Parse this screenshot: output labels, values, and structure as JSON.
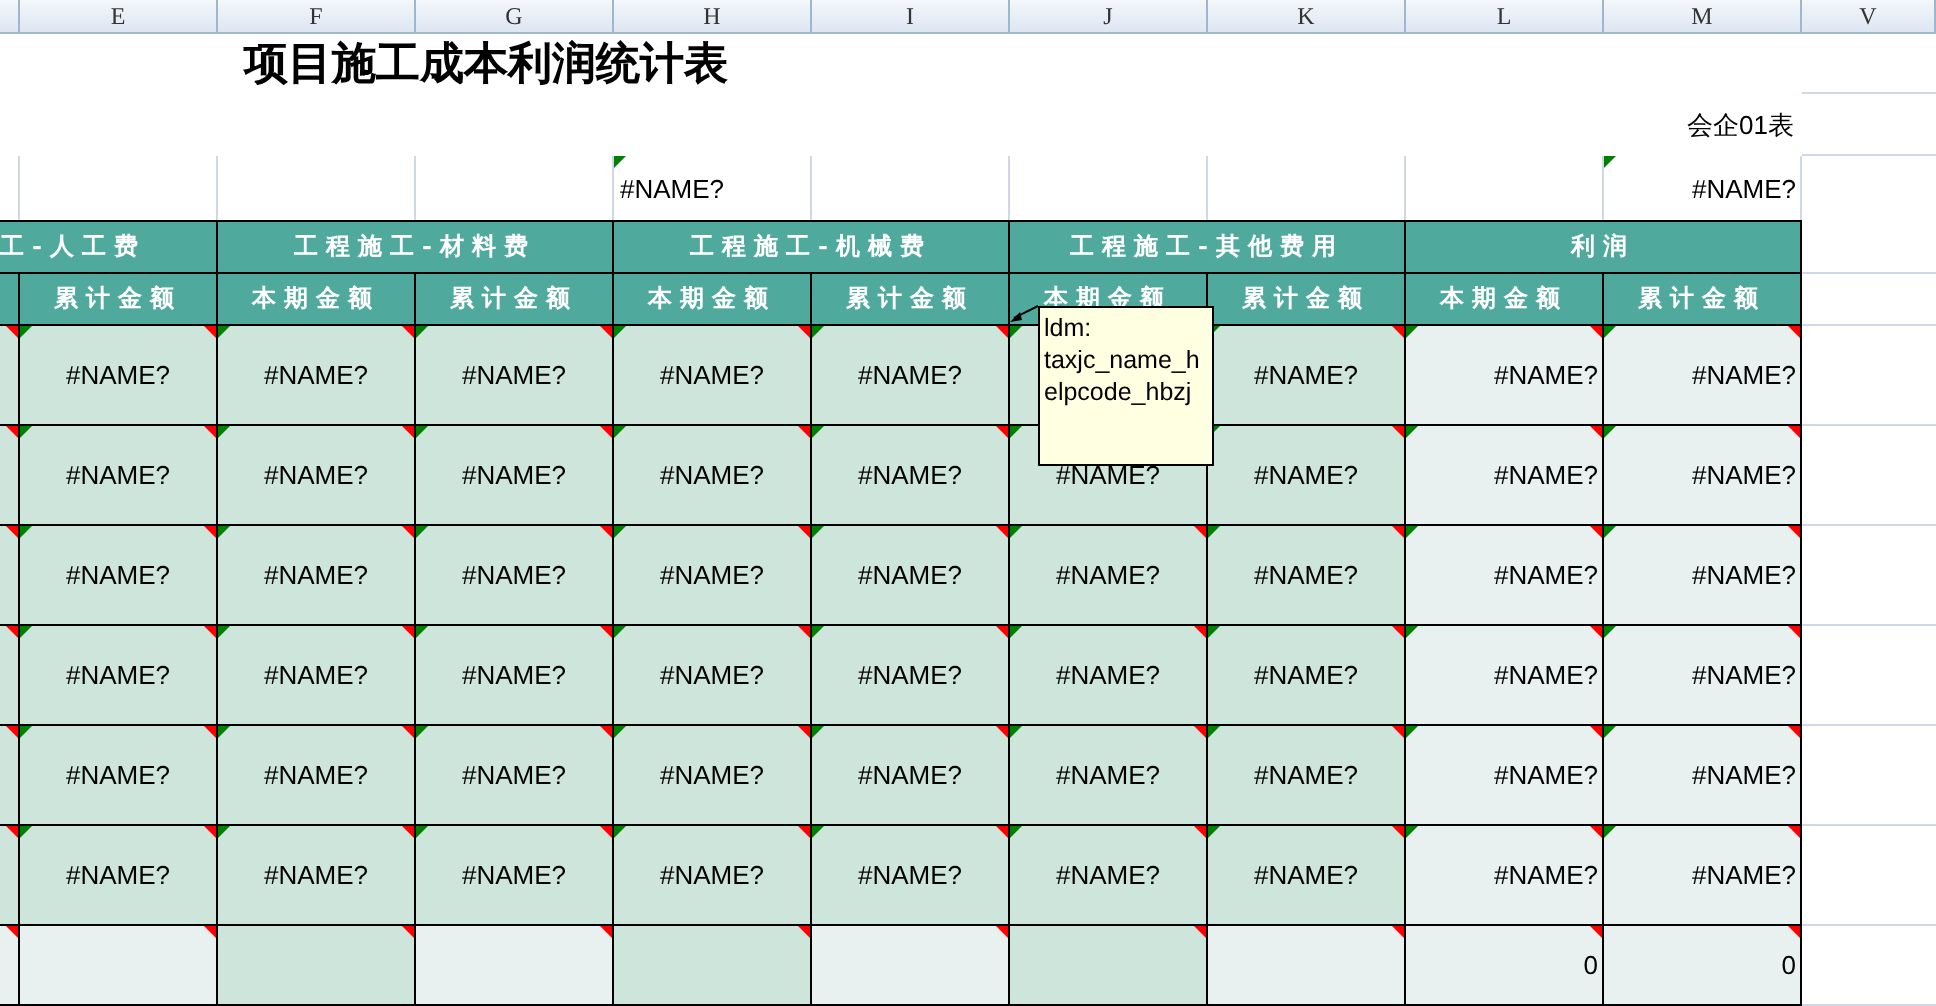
{
  "column_letters": [
    "E",
    "F",
    "G",
    "H",
    "I",
    "J",
    "K",
    "L",
    "M",
    "V"
  ],
  "title": "项目施工成本利润统计表",
  "form_code": "会企01表",
  "top_cells": [
    {
      "text": "#NAME?"
    },
    {
      "text": "#NAME?"
    }
  ],
  "group_headers": [
    "工-人工费",
    "工程施工-材料费",
    "工程施工-机械费",
    "工程施工-其他费用",
    "利润"
  ],
  "sub_headers": [
    "累计金额",
    "本期金额",
    "累计金额",
    "本期金额",
    "累计金额",
    "本期金额",
    "累计金额",
    "本期金额",
    "累计金额"
  ],
  "rows": [
    {
      "kind": "data",
      "cells": [
        {
          "text": "#NAME?",
          "color": "#cde5da"
        },
        {
          "text": "#NAME?",
          "color": "#cde5da"
        },
        {
          "text": "#NAME?",
          "color": "#cde5da"
        },
        {
          "text": "#NAME?",
          "color": "#cde5da"
        },
        {
          "text": "#NAME?",
          "color": "#cde5da"
        },
        {
          "color": "#cde5da"
        },
        {
          "text": "#NAME?",
          "color": "#cde5da"
        },
        {
          "text": "#NAME?",
          "color": "#e8f1ef"
        },
        {
          "text": "#NAME?",
          "color": "#e8f1ef"
        }
      ]
    },
    {
      "kind": "data",
      "cells": [
        {
          "text": "#NAME?",
          "color": "#cde5da"
        },
        {
          "text": "#NAME?",
          "color": "#cde5da"
        },
        {
          "text": "#NAME?",
          "color": "#cde5da"
        },
        {
          "text": "#NAME?",
          "color": "#cde5da"
        },
        {
          "text": "#NAME?",
          "color": "#cde5da"
        },
        {
          "text": "#NAME?",
          "color": "#cde5da"
        },
        {
          "text": "#NAME?",
          "color": "#cde5da"
        },
        {
          "text": "#NAME?",
          "color": "#e8f1ef"
        },
        {
          "text": "#NAME?",
          "color": "#e8f1ef"
        }
      ]
    },
    {
      "kind": "data",
      "cells": [
        {
          "text": "#NAME?",
          "color": "#cde5da"
        },
        {
          "text": "#NAME?",
          "color": "#cde5da"
        },
        {
          "text": "#NAME?",
          "color": "#cde5da"
        },
        {
          "text": "#NAME?",
          "color": "#cde5da"
        },
        {
          "text": "#NAME?",
          "color": "#cde5da"
        },
        {
          "text": "#NAME?",
          "color": "#cde5da"
        },
        {
          "text": "#NAME?",
          "color": "#cde5da"
        },
        {
          "text": "#NAME?",
          "color": "#e8f1ef"
        },
        {
          "text": "#NAME?",
          "color": "#e8f1ef"
        }
      ]
    },
    {
      "kind": "data",
      "cells": [
        {
          "text": "#NAME?",
          "color": "#cde5da"
        },
        {
          "text": "#NAME?",
          "color": "#cde5da"
        },
        {
          "text": "#NAME?",
          "color": "#cde5da"
        },
        {
          "text": "#NAME?",
          "color": "#cde5da"
        },
        {
          "text": "#NAME?",
          "color": "#cde5da"
        },
        {
          "text": "#NAME?",
          "color": "#cde5da"
        },
        {
          "text": "#NAME?",
          "color": "#cde5da"
        },
        {
          "text": "#NAME?",
          "color": "#e8f1ef"
        },
        {
          "text": "#NAME?",
          "color": "#e8f1ef"
        }
      ]
    },
    {
      "kind": "data",
      "cells": [
        {
          "text": "#NAME?",
          "color": "#cde5da"
        },
        {
          "text": "#NAME?",
          "color": "#cde5da"
        },
        {
          "text": "#NAME?",
          "color": "#cde5da"
        },
        {
          "text": "#NAME?",
          "color": "#cde5da"
        },
        {
          "text": "#NAME?",
          "color": "#cde5da"
        },
        {
          "text": "#NAME?",
          "color": "#cde5da"
        },
        {
          "text": "#NAME?",
          "color": "#cde5da"
        },
        {
          "text": "#NAME?",
          "color": "#e8f1ef"
        },
        {
          "text": "#NAME?",
          "color": "#e8f1ef"
        }
      ]
    },
    {
      "kind": "data",
      "cells": [
        {
          "text": "#NAME?",
          "color": "#cde5da"
        },
        {
          "text": "#NAME?",
          "color": "#cde5da"
        },
        {
          "text": "#NAME?",
          "color": "#cde5da"
        },
        {
          "text": "#NAME?",
          "color": "#cde5da"
        },
        {
          "text": "#NAME?",
          "color": "#cde5da"
        },
        {
          "text": "#NAME?",
          "color": "#cde5da"
        },
        {
          "text": "#NAME?",
          "color": "#cde5da"
        },
        {
          "text": "#NAME?",
          "color": "#e8f1ef"
        },
        {
          "text": "#NAME?",
          "color": "#e8f1ef"
        }
      ]
    },
    {
      "kind": "total",
      "cells": [
        {
          "color": "#e8f1ef"
        },
        {
          "color": "#cde5da"
        },
        {
          "color": "#e8f1ef"
        },
        {
          "color": "#cde5da"
        },
        {
          "color": "#e8f1ef"
        },
        {
          "color": "#cde5da"
        },
        {
          "color": "#e8f1ef"
        },
        {
          "text": "0",
          "color": "#e8f1ef"
        },
        {
          "text": "0",
          "color": "#e8f1ef"
        }
      ]
    }
  ],
  "comment": {
    "lines": [
      "ldm:",
      "taxjc_name_h",
      "elpcode_hbzj"
    ]
  }
}
